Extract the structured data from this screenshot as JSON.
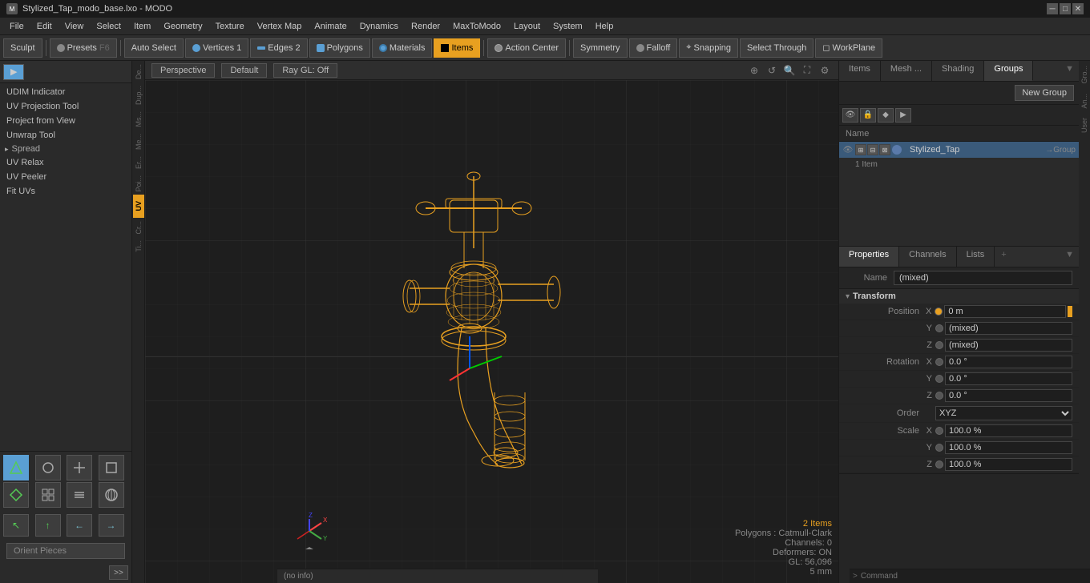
{
  "titlebar": {
    "title": "Stylized_Tap_modo_base.lxo - MODO",
    "icon": "M"
  },
  "menubar": {
    "items": [
      "File",
      "Edit",
      "View",
      "Select",
      "Item",
      "Geometry",
      "Texture",
      "Vertex Map",
      "Animate",
      "Dynamics",
      "Render",
      "MaxToModo",
      "Layout",
      "System",
      "Help"
    ]
  },
  "toolbar": {
    "sculpt_label": "Sculpt",
    "presets_label": "Presets",
    "presets_key": "F6",
    "auto_select_label": "Auto Select",
    "vertices_label": "Vertices",
    "vertices_count": "1",
    "edges_label": "Edges",
    "edges_count": "2",
    "polygons_label": "Polygons",
    "materials_label": "Materials",
    "items_label": "Items",
    "action_center_label": "Action Center",
    "symmetry_label": "Symmetry",
    "falloff_label": "Falloff",
    "snapping_label": "Snapping",
    "select_through_label": "Select Through",
    "workplane_label": "WorkPlane"
  },
  "left_panel": {
    "tools": [
      "UDIM Indicator",
      "UV Projection Tool",
      "Project from View",
      "Unwrap Tool",
      "Spread",
      "UV Relax",
      "UV Peeler",
      "Fit UVs",
      "Orient Pieces"
    ],
    "section_spread_label": "Spread",
    "orient_pieces_label": "Orient Pieces"
  },
  "viewport": {
    "tabs": [
      "Perspective",
      "Default",
      "Ray GL: Off"
    ],
    "info": {
      "items": "2 Items",
      "polygons": "Polygons : Catmull-Clark",
      "channels": "Channels: 0",
      "deformers": "Deformers: ON",
      "gl": "GL: 56,096",
      "scale": "5 mm"
    }
  },
  "right_panel": {
    "tabs": [
      "Items",
      "Mesh ...",
      "Shading",
      "Groups"
    ],
    "active_tab": "Groups",
    "new_group_label": "New Group",
    "items_toolbar_icons": [
      "eye",
      "lock",
      "render",
      "anim"
    ],
    "name_col": "Name",
    "item": {
      "name": "Stylized_Tap",
      "type": "→Group",
      "count": "1 Item"
    }
  },
  "properties": {
    "tabs": [
      "Properties",
      "Channels",
      "Lists"
    ],
    "active_tab": "Properties",
    "name_value": "(mixed)",
    "sections": {
      "transform": {
        "title": "Transform",
        "position": {
          "label": "Position",
          "x": "0 m",
          "y": "(mixed)",
          "z": "(mixed)"
        },
        "rotation": {
          "label": "Rotation",
          "x": "0.0 °",
          "y": "0.0 °",
          "z": "0.0 °"
        },
        "order": {
          "label": "Order",
          "value": "XYZ"
        },
        "scale": {
          "label": "Scale",
          "x": "100.0 %",
          "y": "100.0 %",
          "z": "100.0 %"
        }
      }
    }
  },
  "right_strip": {
    "items": [
      "Gro...",
      "An...",
      "User"
    ]
  },
  "statusbar": {
    "text": "(no info)"
  },
  "command": {
    "placeholder": "Command",
    "prompt": ">"
  },
  "vert_strip": {
    "labels": [
      "De...",
      "Dup...",
      "Ms...",
      "Me...",
      "Er...",
      "Poi...",
      "Cr...",
      "Ti..."
    ],
    "active": "UV"
  }
}
